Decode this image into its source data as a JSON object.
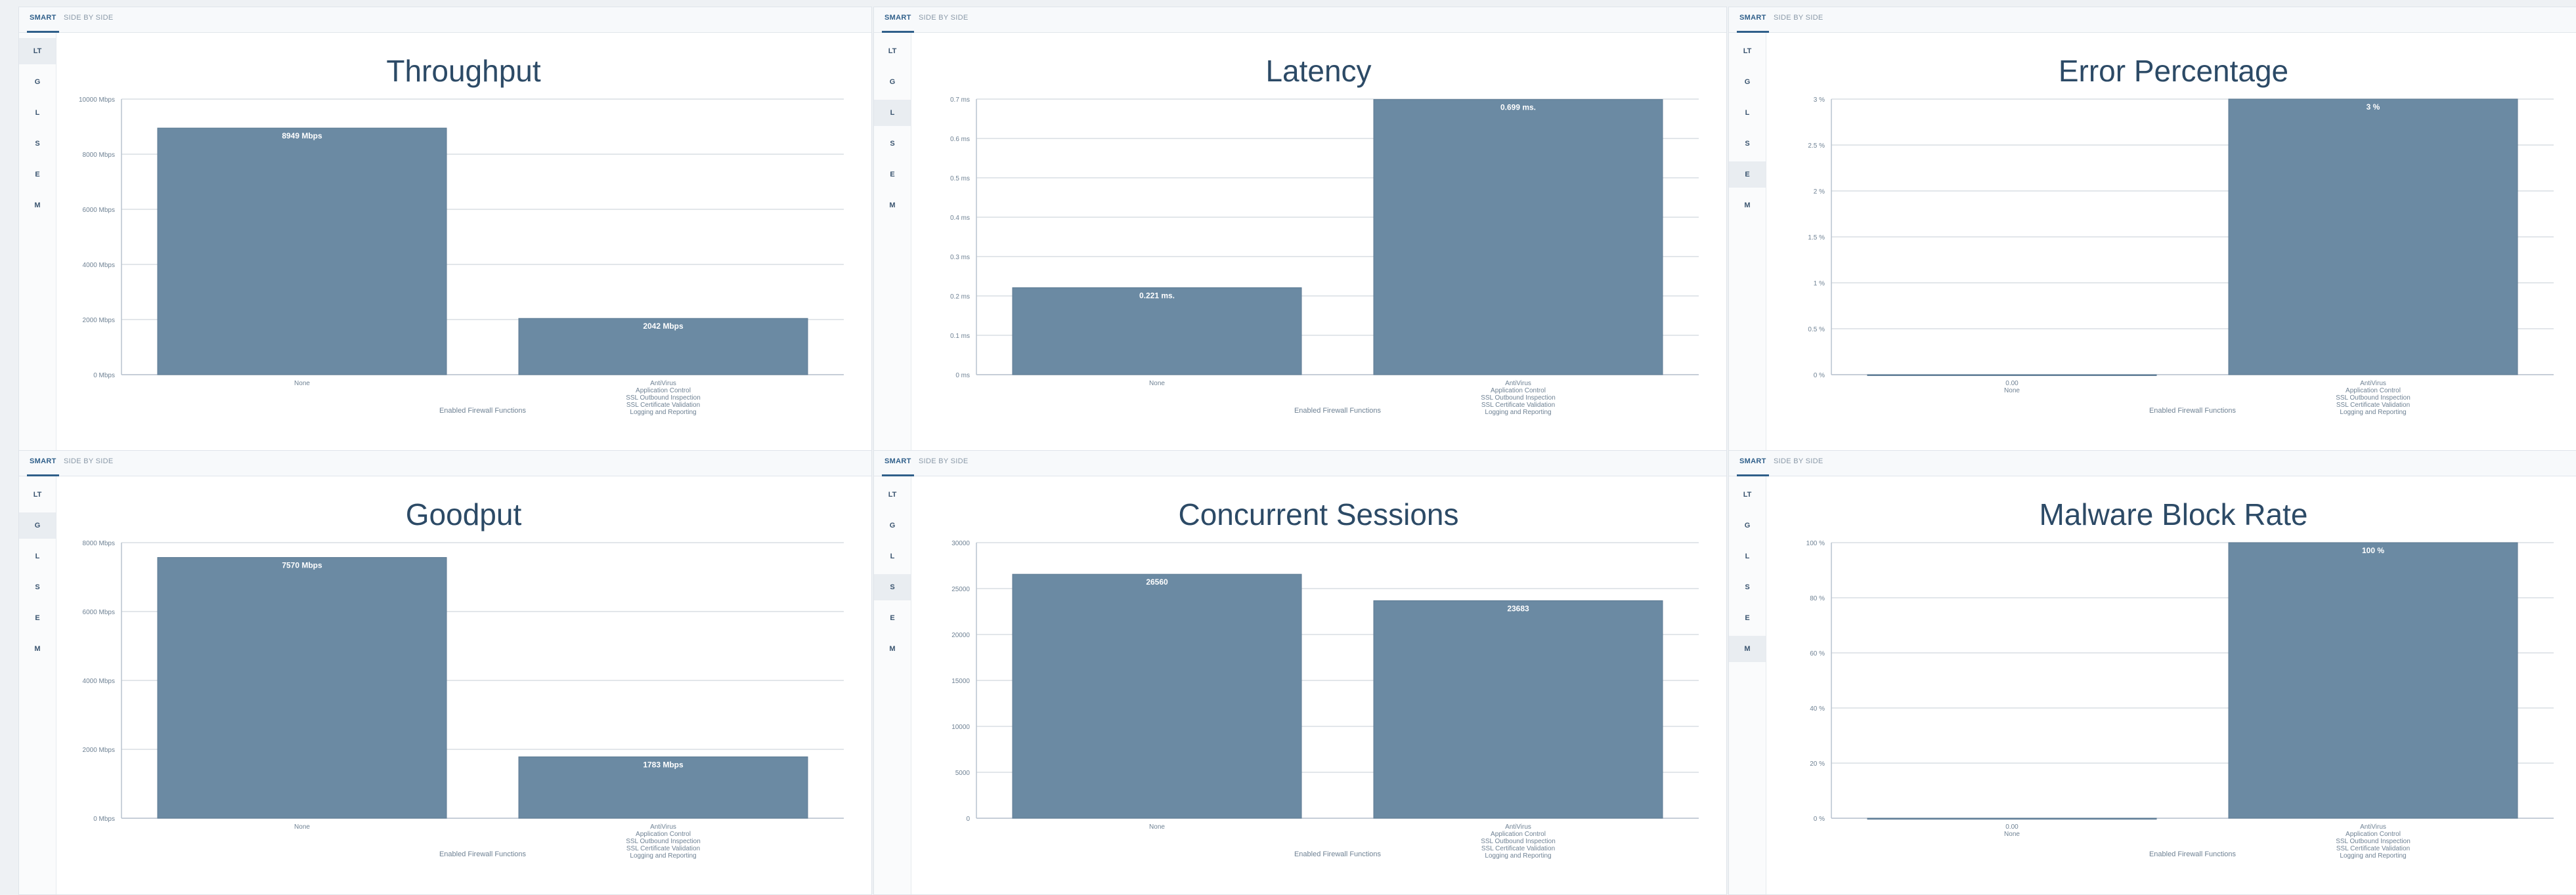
{
  "tabs": {
    "smart": "SMART",
    "side_by_side": "SIDE BY SIDE"
  },
  "rail": [
    "LT",
    "G",
    "L",
    "S",
    "E",
    "M"
  ],
  "x_axis_label": "Enabled Firewall Functions",
  "bar_color": "#6b8aa3",
  "panels": [
    {
      "id": "throughput",
      "active_rail": 0,
      "chart_data": {
        "type": "bar",
        "title": "Throughput",
        "categories": [
          "None",
          "AntiVirus\nApplication Control\nSSL Outbound Inspection\nSSL Certificate Validation\nLogging and Reporting"
        ],
        "values": [
          8949,
          2042
        ],
        "value_labels": [
          "8949 Mbps",
          "2042 Mbps"
        ],
        "ylim": [
          0,
          10000
        ],
        "yticks": [
          0,
          2000,
          4000,
          6000,
          8000,
          10000
        ],
        "ytick_labels": [
          "0 Mbps",
          "2000 Mbps",
          "4000 Mbps",
          "6000 Mbps",
          "8000 Mbps",
          "10000 Mbps"
        ],
        "xlabel": "Enabled Firewall Functions",
        "ylabel": ""
      }
    },
    {
      "id": "latency",
      "active_rail": 2,
      "chart_data": {
        "type": "bar",
        "title": "Latency",
        "categories": [
          "None",
          "AntiVirus\nApplication Control\nSSL Outbound Inspection\nSSL Certificate Validation\nLogging and Reporting"
        ],
        "values": [
          0.221,
          0.699
        ],
        "value_labels": [
          "0.221 ms.",
          "0.699 ms."
        ],
        "ylim": [
          0,
          0.7
        ],
        "yticks": [
          0,
          0.1,
          0.2,
          0.3,
          0.4,
          0.5,
          0.6,
          0.7
        ],
        "ytick_labels": [
          "0 ms",
          "0.1 ms",
          "0.2 ms",
          "0.3 ms",
          "0.4 ms",
          "0.5 ms",
          "0.6 ms",
          "0.7 ms"
        ],
        "xlabel": "Enabled Firewall Functions",
        "ylabel": ""
      }
    },
    {
      "id": "error",
      "active_rail": 4,
      "chart_data": {
        "type": "bar",
        "title": "Error Percentage",
        "categories": [
          "0.00\nNone",
          "AntiVirus\nApplication Control\nSSL Outbound Inspection\nSSL Certificate Validation\nLogging and Reporting"
        ],
        "values": [
          0,
          3
        ],
        "value_labels": [
          "",
          "3 %"
        ],
        "ylim": [
          0,
          3
        ],
        "yticks": [
          0,
          0.5,
          1,
          1.5,
          2,
          2.5,
          3
        ],
        "ytick_labels": [
          "0 %",
          "0.5 %",
          "1 %",
          "1.5 %",
          "2 %",
          "2.5 %",
          "3 %"
        ],
        "xlabel": "Enabled Firewall Functions",
        "ylabel": ""
      }
    },
    {
      "id": "goodput",
      "active_rail": 1,
      "chart_data": {
        "type": "bar",
        "title": "Goodput",
        "categories": [
          "None",
          "AntiVirus\nApplication Control\nSSL Outbound Inspection\nSSL Certificate Validation\nLogging and Reporting"
        ],
        "values": [
          7570,
          1783
        ],
        "value_labels": [
          "7570 Mbps",
          "1783 Mbps"
        ],
        "ylim": [
          0,
          8000
        ],
        "yticks": [
          0,
          2000,
          4000,
          6000,
          8000
        ],
        "ytick_labels": [
          "0 Mbps",
          "2000 Mbps",
          "4000 Mbps",
          "6000 Mbps",
          "8000 Mbps"
        ],
        "xlabel": "Enabled Firewall Functions",
        "ylabel": ""
      }
    },
    {
      "id": "sessions",
      "active_rail": 3,
      "chart_data": {
        "type": "bar",
        "title": "Concurrent Sessions",
        "categories": [
          "None",
          "AntiVirus\nApplication Control\nSSL Outbound Inspection\nSSL Certificate Validation\nLogging and Reporting"
        ],
        "values": [
          26560,
          23683
        ],
        "value_labels": [
          "26560",
          "23683"
        ],
        "ylim": [
          0,
          30000
        ],
        "yticks": [
          0,
          5000,
          10000,
          15000,
          20000,
          25000,
          30000
        ],
        "ytick_labels": [
          "0",
          "5000",
          "10000",
          "15000",
          "20000",
          "25000",
          "30000"
        ],
        "xlabel": "Enabled Firewall Functions",
        "ylabel": ""
      }
    },
    {
      "id": "malware",
      "active_rail": 5,
      "chart_data": {
        "type": "bar",
        "title": "Malware Block Rate",
        "categories": [
          "0.00\nNone",
          "AntiVirus\nApplication Control\nSSL Outbound Inspection\nSSL Certificate Validation\nLogging and Reporting"
        ],
        "values": [
          0,
          100
        ],
        "value_labels": [
          "",
          "100 %"
        ],
        "ylim": [
          0,
          100
        ],
        "yticks": [
          0,
          20,
          40,
          60,
          80,
          100
        ],
        "ytick_labels": [
          "0 %",
          "20 %",
          "40 %",
          "60 %",
          "80 %",
          "100 %"
        ],
        "xlabel": "Enabled Firewall Functions",
        "ylabel": ""
      }
    }
  ]
}
